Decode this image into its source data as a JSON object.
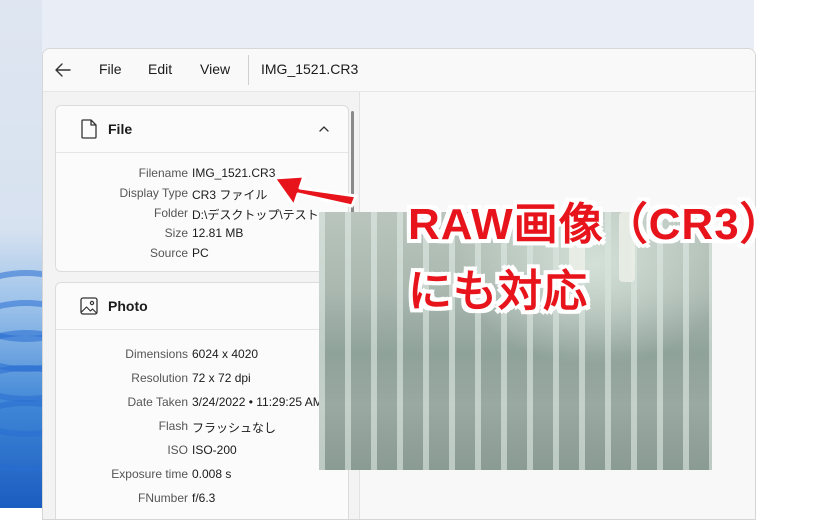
{
  "window": {
    "title": "IMG_1521.CR3",
    "menu": [
      "File",
      "Edit",
      "View"
    ]
  },
  "file_section": {
    "title": "File",
    "fields": [
      {
        "label": "Filename",
        "value": "IMG_1521.CR3"
      },
      {
        "label": "Display Type",
        "value": "CR3 ファイル"
      },
      {
        "label": "Folder",
        "value": "D:\\デスクトップ\\テスト"
      },
      {
        "label": "Size",
        "value": "12.81 MB"
      },
      {
        "label": "Source",
        "value": "PC"
      }
    ]
  },
  "photo_section": {
    "title": "Photo",
    "fields": [
      {
        "label": "Dimensions",
        "value": "6024 x 4020"
      },
      {
        "label": "Resolution",
        "value": "72 x 72 dpi"
      },
      {
        "label": "Date Taken",
        "value": "3/24/2022 • 11:29:25 AM"
      },
      {
        "label": "Flash",
        "value": "フラッシュなし"
      },
      {
        "label": "ISO",
        "value": "ISO-200"
      },
      {
        "label": "Exposure time",
        "value": "0.008 s"
      },
      {
        "label": "FNumber",
        "value": "f/6.3"
      }
    ]
  },
  "annotation": {
    "line1": "RAW画像（CR3）",
    "line2": "にも対応",
    "color": "#e8141c"
  },
  "icons": {
    "back": "back-arrow-icon",
    "file": "document-icon",
    "photo": "image-icon",
    "collapse": "chevron-up-icon"
  }
}
